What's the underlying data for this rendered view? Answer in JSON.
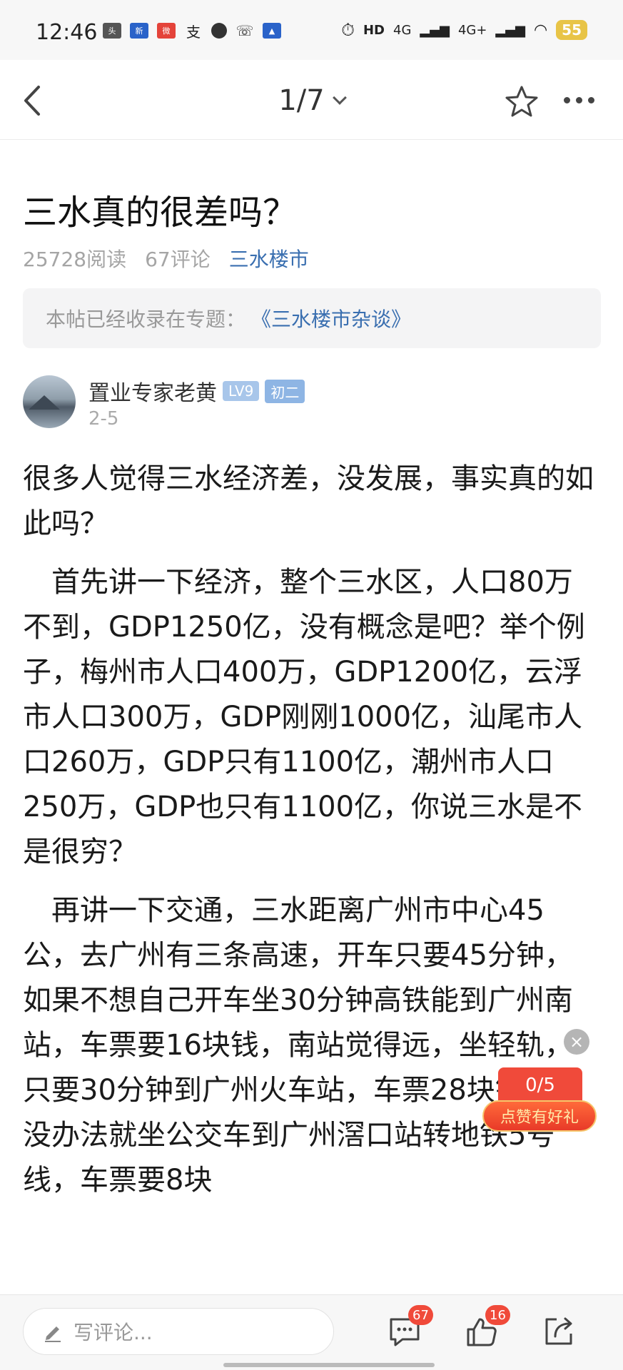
{
  "status_bar": {
    "time": "12:46",
    "left_icons": [
      "toutiao-app-icon",
      "app-icon",
      "weibo-icon",
      "alipay-icon",
      "message-icon",
      "phone-icon",
      "nav-icon"
    ],
    "right_text": "HD",
    "network_1": "4G",
    "network_2": "4G+",
    "battery": "55"
  },
  "nav": {
    "page_indicator": "1/7"
  },
  "post": {
    "title": "三水真的很差吗？",
    "reads": "25728阅读",
    "comments": "67评论",
    "category": "三水楼市",
    "topic_prefix": "本帖已经收录在专题：",
    "topic_link": "《三水楼市杂谈》"
  },
  "author": {
    "name": "置业专家老黄",
    "level": "LV9",
    "grade": "初二",
    "date": "2-5"
  },
  "content": {
    "p1": "很多人觉得三水经济差，没发展，事实真的如此吗？",
    "p2": "首先讲一下经济，整个三水区，人口80万不到，GDP1250亿，没有概念是吧？举个例子，梅州市人口400万，GDP1200亿，云浮市人口300万，GDP刚刚1000亿，汕尾市人口260万，GDP只有1100亿，潮州市人口250万，GDP也只有1100亿，你说三水是不是很穷？",
    "p3": "再讲一下交通，三水距离广州市中心45公，去广州有三条高速，开车只要45分钟，如果不想自己开车坐30分钟高铁能到广州南站，车票要16块钱，南站觉得远，坐轻轨，只要30分钟到广州火车站，车票28块钱，再没办法就坐公交车到广州滘口站转地铁5号线，车票要8块"
  },
  "reward": {
    "count": "0/5",
    "label": "点赞有好礼",
    "close": "×"
  },
  "bottom_bar": {
    "comment_placeholder": "写评论...",
    "comment_count": "67",
    "like_count": "16"
  }
}
